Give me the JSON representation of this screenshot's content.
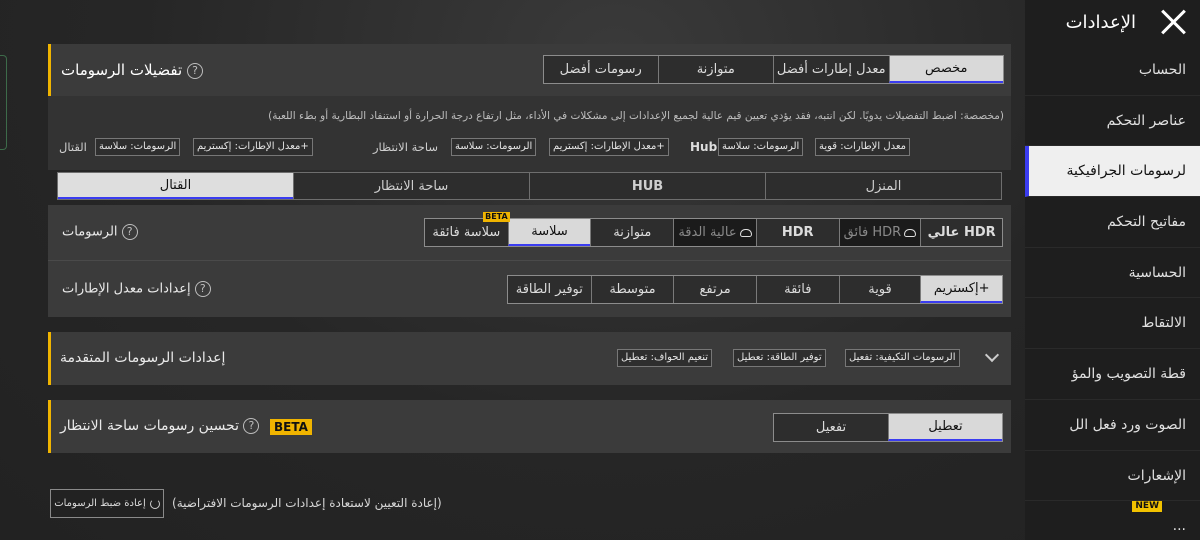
{
  "sidebar": {
    "title": "الإعدادات",
    "items": [
      {
        "label": "الحساب"
      },
      {
        "label": "عناصر التحكم"
      },
      {
        "label": "لرسومات الجرافيكية"
      },
      {
        "label": "مفاتيح التحكم"
      },
      {
        "label": "الحساسية"
      },
      {
        "label": "الالتقاط"
      },
      {
        "label": "قطة التصويب والمؤ"
      },
      {
        "label": "الصوت ورد فعل الل"
      },
      {
        "label": "الإشعارات"
      },
      {
        "label": "...",
        "badge": "NEW"
      }
    ]
  },
  "prefs": {
    "title": "تفضيلات الرسومات",
    "options": [
      "مخصص",
      "معدل إطارات أفضل",
      "متوازنة",
      "رسومات أفضل"
    ],
    "selected": 0,
    "note": "(مخصصة: اضبط التفضيلات يدويًا. لكن انتبه، فقد يؤدي تعيين قيم عالية لجميع الإعدادات إلى مشكلات في الأداء، مثل ارتفاع درجة الحرارة أو استنفاد البطارية أو بطء اللعبة)",
    "groups": {
      "hub": {
        "fps": "معدل الإطارات: قوية",
        "gfx": "الرسومات: سلاسة",
        "word": "Hub"
      },
      "lobby": {
        "fps": "معدل الإطارات: إكستريم+",
        "gfx": "الرسومات: سلاسة",
        "label": "ساحة الانتظار"
      },
      "combat": {
        "fps": "معدل الإطارات: إكستريم+",
        "gfx": "الرسومات: سلاسة",
        "label": "القتال"
      }
    }
  },
  "modes": {
    "tabs": [
      "المنزل",
      "HUB",
      "ساحة الانتظار",
      "القتال"
    ],
    "selected": 3
  },
  "graphics": {
    "label": "الرسومات",
    "options": [
      "عالي HDR",
      "فائق HDR",
      "HDR",
      "عالية الدقة",
      "متوازنة",
      "سلاسة",
      "سلاسة فائقة"
    ],
    "selected": 5,
    "beta_tag": "BETA"
  },
  "fps": {
    "label": "إعدادات معدل الإطارات",
    "options": [
      "إكستريم+",
      "قوية",
      "فائقة",
      "مرتفع",
      "متوسطة",
      "توفير الطاقة"
    ],
    "selected": 0
  },
  "advanced": {
    "title": "إعدادات الرسومات المتقدمة",
    "tags": [
      "الرسومات التكيفية: تفعيل",
      "توفير الطاقة: تعطيل",
      "تنعيم الحواف: تعطيل"
    ]
  },
  "lobby_enhance": {
    "title": "تحسين رسومات ساحة الانتظار",
    "badge": "BETA",
    "options": [
      "تعطيل",
      "تفعيل"
    ],
    "selected": 0
  },
  "reset": {
    "button": "إعادة ضبط الرسومات",
    "text": "(إعادة التعيين لاستعادة إعدادات الرسومات الافتراضية)"
  },
  "colors": {
    "accent": "#f0b400",
    "selection": "#3a3cf0"
  }
}
